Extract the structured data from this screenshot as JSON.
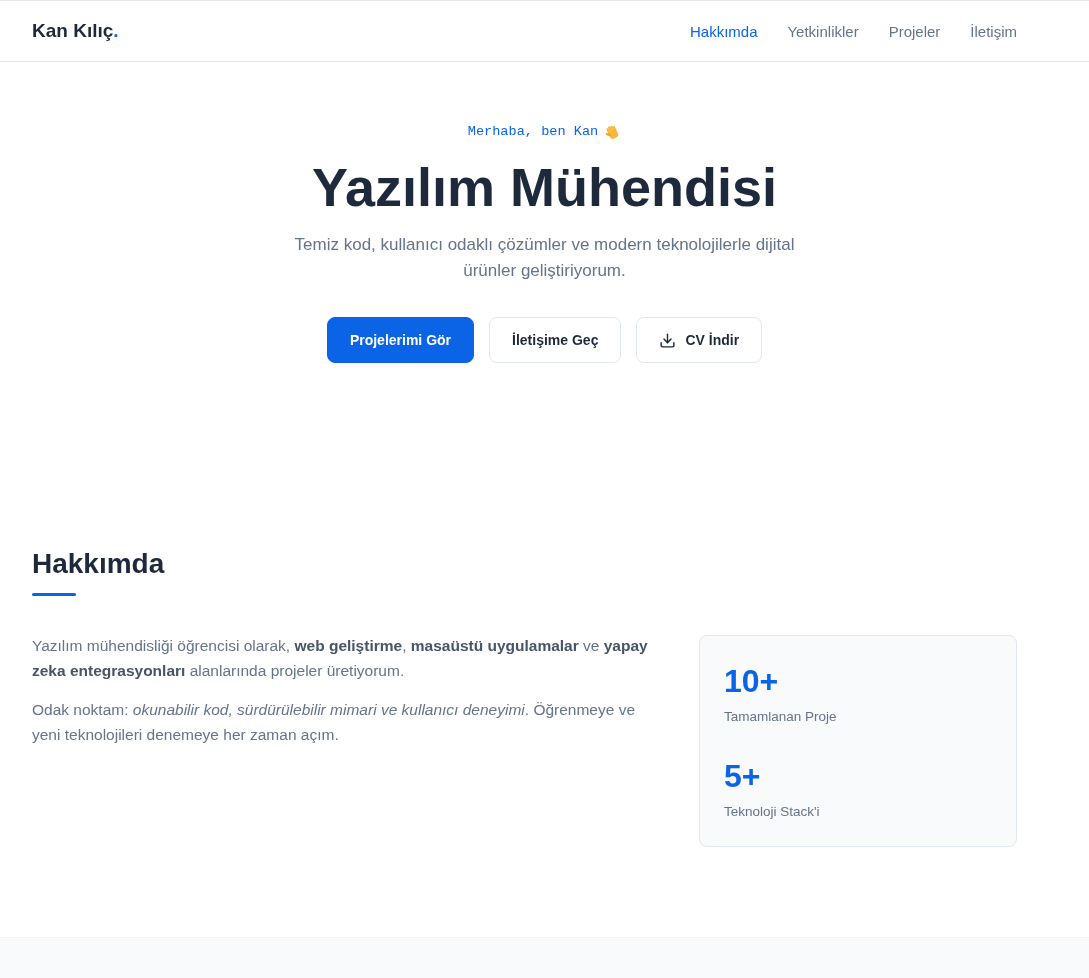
{
  "header": {
    "logo": {
      "text": "Kan Kılıç",
      "accent": "."
    },
    "nav": [
      {
        "label": "Hakkımda",
        "selected": true
      },
      {
        "label": "Yetkinlikler",
        "selected": false
      },
      {
        "label": "Projeler",
        "selected": false
      },
      {
        "label": "İletişim",
        "selected": false
      }
    ]
  },
  "hero": {
    "greeting": "Merhaba, ben Kan",
    "title": "Yazılım Mühendisi",
    "subtitle": "Temiz kod, kullanıcı odaklı çözümler ve modern teknolojilerle dijital ürünler geliştiriyorum.",
    "buttons": [
      {
        "label": "Projelerimi Gör",
        "kind": "primary"
      },
      {
        "label": "İletişime Geç",
        "kind": "secondary"
      },
      {
        "label": "CV İndir",
        "kind": "download"
      }
    ]
  },
  "about": {
    "heading": "Hakkımda",
    "paragraphs": [
      "Yazılım mühendisliği öğrencisi olarak, **web geliştirme**, **masaüstü uygulamalar** ve **yapay zeka entegrasyonları** alanlarında projeler üretiyorum.",
      "Odak noktam: *okunabilir kod, sürdürülebilir mimari ve kullanıcı deneyimi*. Öğrenmeye ve yeni teknolojileri denemeye her zaman açım."
    ],
    "stats": [
      {
        "value": "10+",
        "label": "Tamamlanan Proje"
      },
      {
        "value": "5+",
        "label": "Teknoloji Stack'i"
      }
    ]
  }
}
